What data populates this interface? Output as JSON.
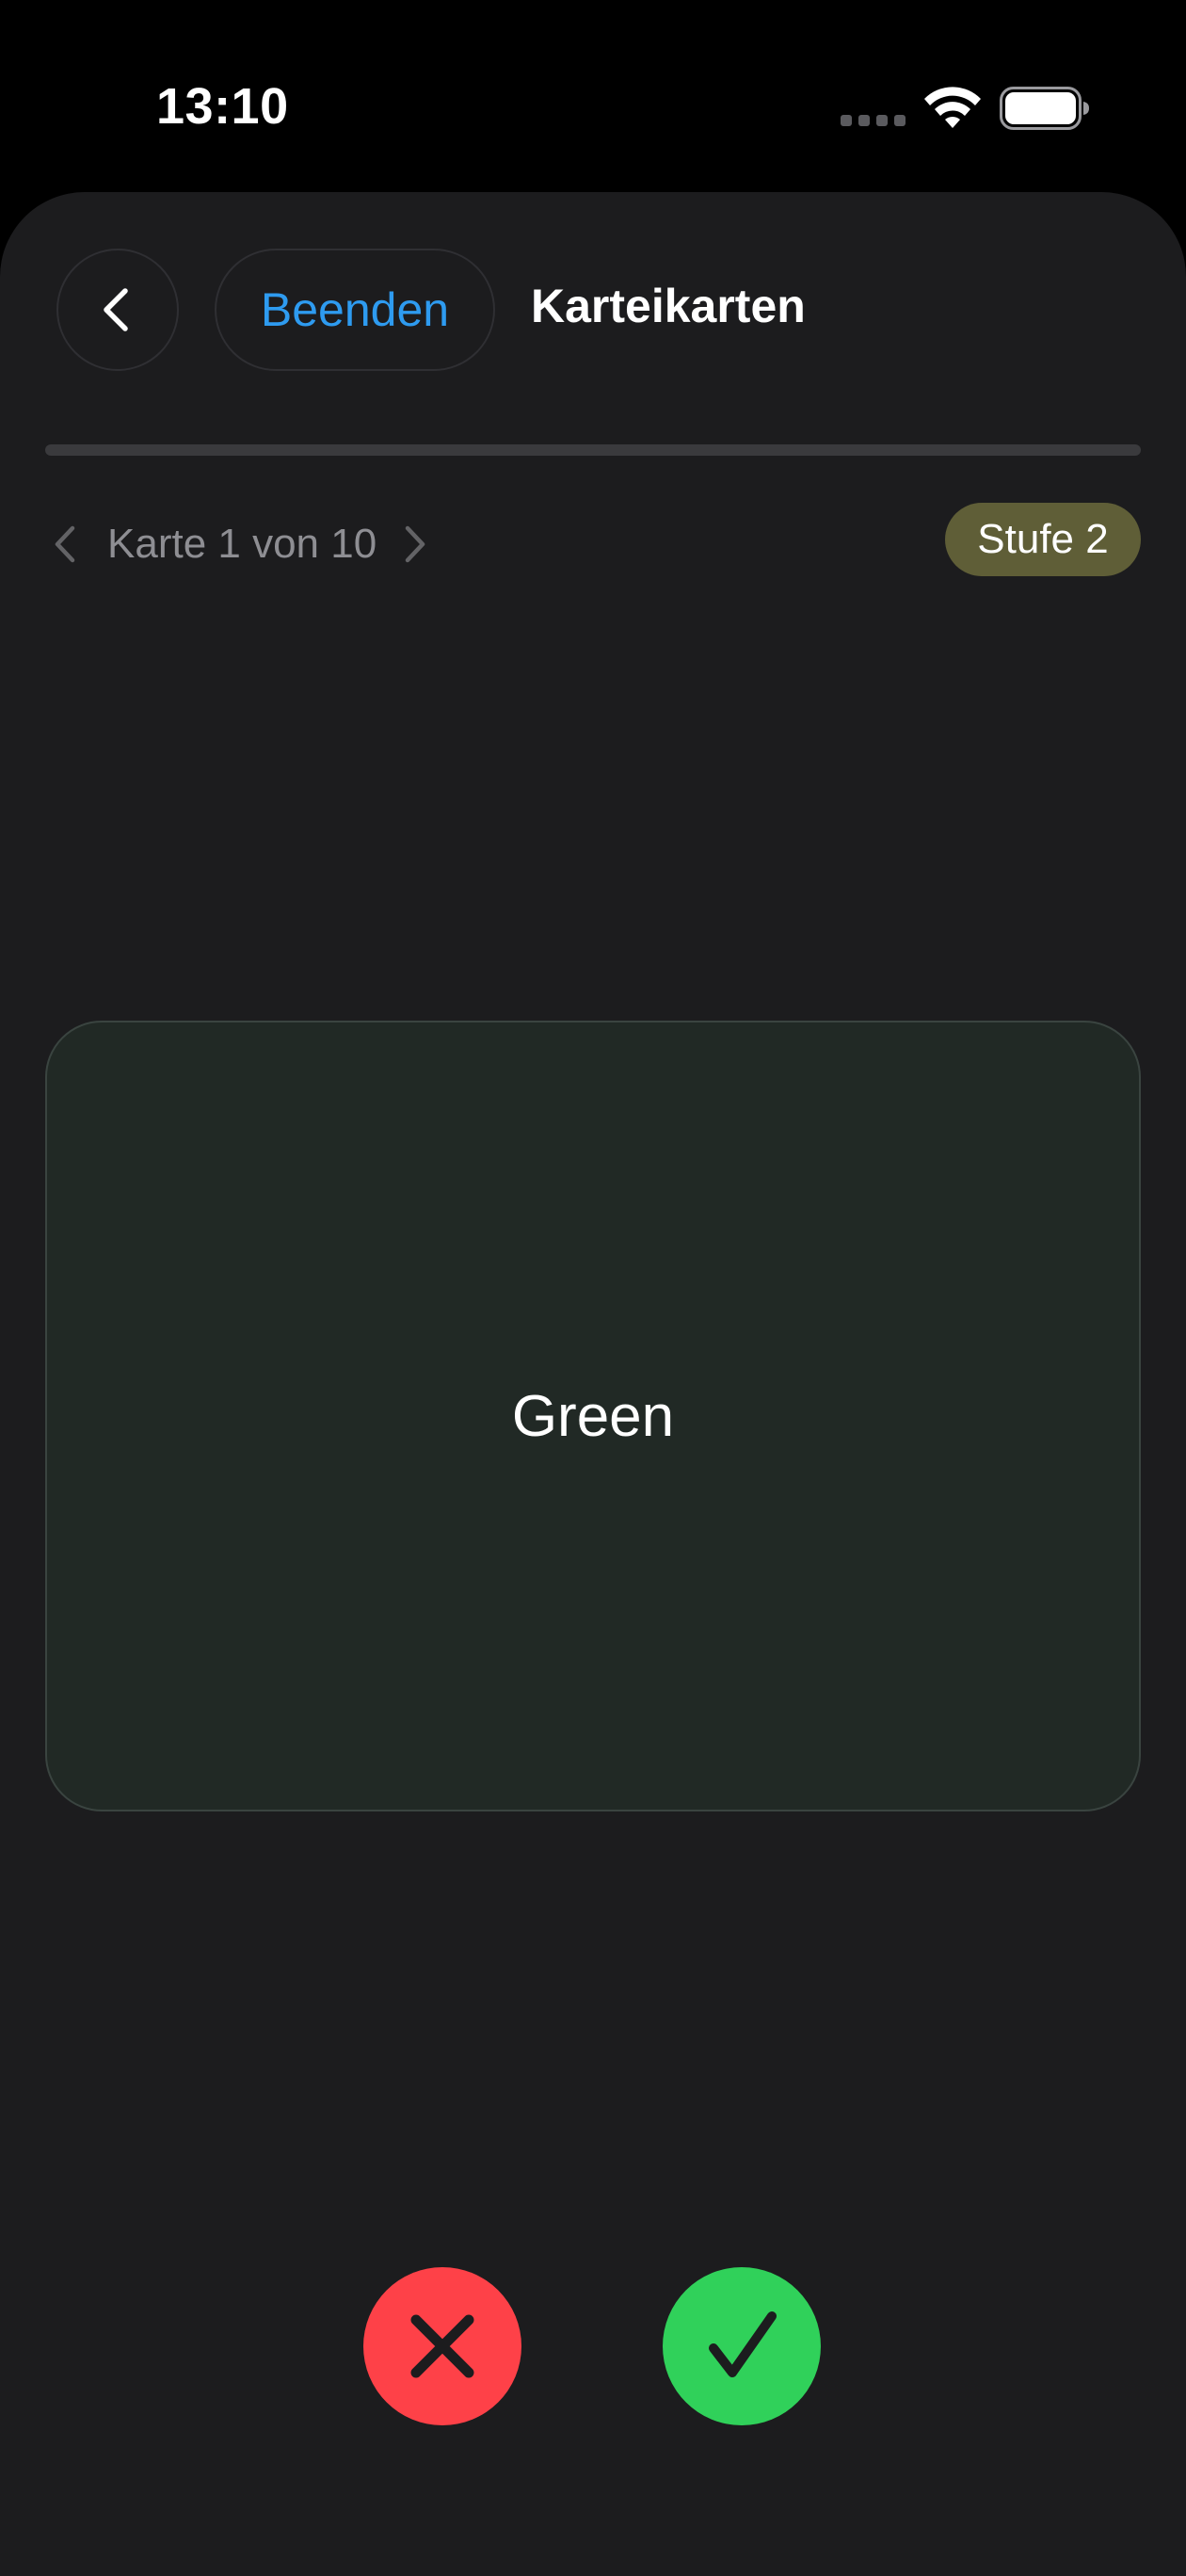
{
  "status_bar": {
    "time": "13:10"
  },
  "header": {
    "end_label": "Beenden",
    "title": "Karteikarten"
  },
  "progress": {
    "fraction": 0.0
  },
  "card_nav": {
    "counter": "Karte 1 von 10"
  },
  "badge": {
    "level": "Stufe 2"
  },
  "card": {
    "text": "Green"
  },
  "colors": {
    "accent_blue": "#2e9bf0",
    "wrong_red": "#fe4148",
    "right_green": "#30d15a",
    "badge_olive": "#5f5e37",
    "card_bg": "#212925"
  },
  "icons": {
    "back": "chevron-left-icon",
    "prev": "chevron-left-icon",
    "next": "chevron-right-icon",
    "wrong": "xmark-icon",
    "right": "checkmark-icon"
  }
}
